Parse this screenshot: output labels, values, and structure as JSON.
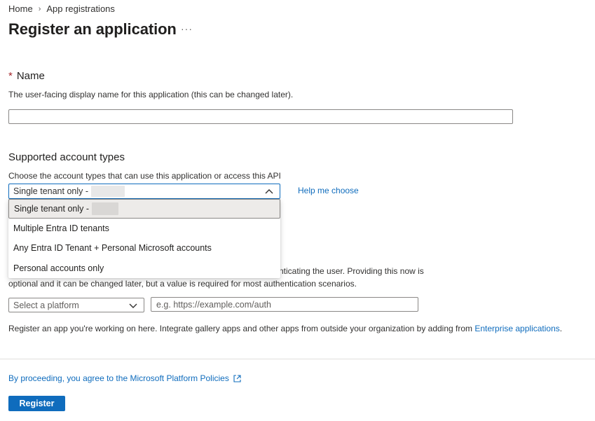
{
  "breadcrumb": {
    "home": "Home",
    "separator": "›",
    "current": "App registrations"
  },
  "page": {
    "title": "Register an application",
    "more": "···"
  },
  "name_section": {
    "required_mark": "*",
    "label": "Name",
    "description": "The user-facing display name for this application (this can be changed later).",
    "value": ""
  },
  "account_types": {
    "label": "Supported account types",
    "description": "Choose the account types that can use this application or access this API",
    "selected": "Single tenant only -",
    "help_link": "Help me choose",
    "options": [
      "Single tenant only -",
      "Multiple Entra ID tenants",
      "Any Entra ID Tenant + Personal Microsoft accounts",
      "Personal accounts only"
    ]
  },
  "redirect": {
    "desc_line1_visible": "nticating the user. Providing this now is",
    "desc_line2": "optional and it can be changed later, but a value is required for most authentication scenarios.",
    "platform_placeholder": "Select a platform",
    "uri_placeholder": "e.g. https://example.com/auth"
  },
  "gallery_note": {
    "text": "Register an app you're working on here. Integrate gallery apps and other apps from outside your organization by adding from ",
    "link": "Enterprise applications",
    "suffix": "."
  },
  "footer": {
    "policy_link": "By proceeding, you agree to the Microsoft Platform Policies",
    "register_label": "Register"
  },
  "colors": {
    "accent": "#0f6cbd",
    "required": "#a4262c"
  }
}
